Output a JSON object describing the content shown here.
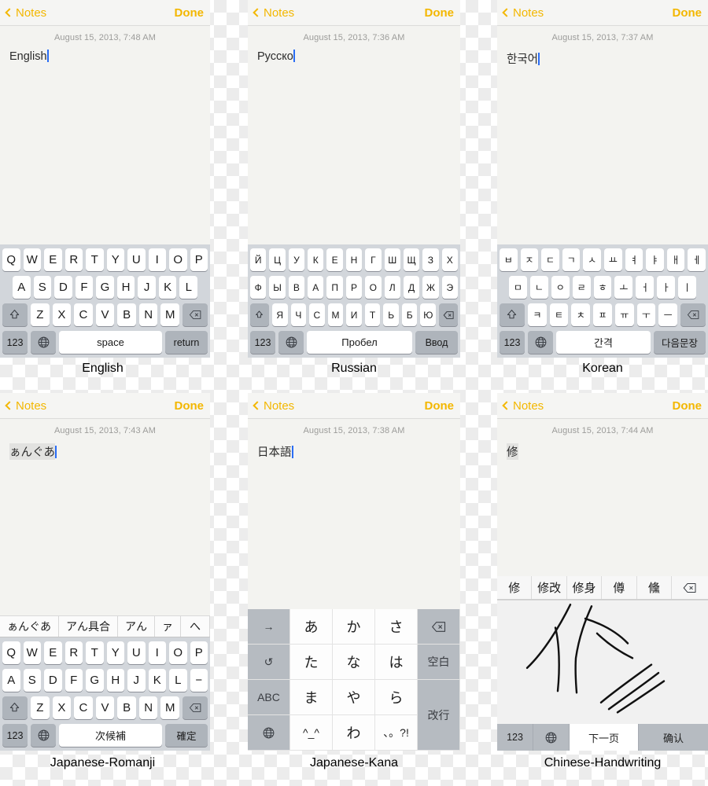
{
  "background": {
    "checker_light": "#ffffff",
    "checker_dark": "#ececec"
  },
  "accent_color": "#f3b700",
  "nav": {
    "back_label": "Notes",
    "done_label": "Done"
  },
  "panels": [
    {
      "caption": "English",
      "date": "August 15, 2013, 7:48 AM",
      "note_text": "English",
      "composing": false,
      "keyboard": {
        "type": "qwerty",
        "rows": [
          [
            "Q",
            "W",
            "E",
            "R",
            "T",
            "Y",
            "U",
            "I",
            "O",
            "P"
          ],
          [
            "A",
            "S",
            "D",
            "F",
            "G",
            "H",
            "J",
            "K",
            "L"
          ],
          [
            "Z",
            "X",
            "C",
            "V",
            "B",
            "N",
            "M"
          ]
        ],
        "shift_label": "shift-icon",
        "delete_label": "delete-icon",
        "numeric_label": "123",
        "globe_label": "globe-icon",
        "space_label": "space",
        "return_label": "return"
      }
    },
    {
      "caption": "Russian",
      "date": "August 15, 2013, 7:36 AM",
      "note_text": "Русско",
      "composing": false,
      "keyboard": {
        "type": "qwerty",
        "rows": [
          [
            "Й",
            "Ц",
            "У",
            "К",
            "Е",
            "Н",
            "Г",
            "Ш",
            "Щ",
            "З",
            "Х"
          ],
          [
            "Ф",
            "Ы",
            "В",
            "А",
            "П",
            "Р",
            "О",
            "Л",
            "Д",
            "Ж",
            "Э"
          ],
          [
            "Я",
            "Ч",
            "С",
            "М",
            "И",
            "Т",
            "Ь",
            "Б",
            "Ю"
          ]
        ],
        "shift_label": "shift-icon",
        "delete_label": "delete-icon",
        "numeric_label": "123",
        "globe_label": "globe-icon",
        "space_label": "Пробел",
        "return_label": "Ввод"
      }
    },
    {
      "caption": "Korean",
      "date": "August 15, 2013, 7:37 AM",
      "note_text": "한국어",
      "composing": false,
      "keyboard": {
        "type": "qwerty",
        "rows": [
          [
            "ㅂ",
            "ㅈ",
            "ㄷ",
            "ㄱ",
            "ㅅ",
            "ㅛ",
            "ㅕ",
            "ㅑ",
            "ㅐ",
            "ㅔ"
          ],
          [
            "ㅁ",
            "ㄴ",
            "ㅇ",
            "ㄹ",
            "ㅎ",
            "ㅗ",
            "ㅓ",
            "ㅏ",
            "ㅣ"
          ],
          [
            "ㅋ",
            "ㅌ",
            "ㅊ",
            "ㅍ",
            "ㅠ",
            "ㅜ",
            "ㅡ"
          ]
        ],
        "shift_label": "shift-icon",
        "delete_label": "delete-icon",
        "numeric_label": "123",
        "globe_label": "globe-icon",
        "space_label": "간격",
        "return_label": "다음문장"
      }
    },
    {
      "caption": "Japanese-Romanji",
      "date": "August 15, 2013, 7:43 AM",
      "note_text": "ぁんぐあ",
      "composing": true,
      "candidates": [
        "ぁんぐあ",
        "アん具合",
        "アん",
        "ァ",
        "へ"
      ],
      "keyboard": {
        "type": "qwerty",
        "rows": [
          [
            "Q",
            "W",
            "E",
            "R",
            "T",
            "Y",
            "U",
            "I",
            "O",
            "P"
          ],
          [
            "A",
            "S",
            "D",
            "F",
            "G",
            "H",
            "J",
            "K",
            "L",
            "−"
          ],
          [
            "Z",
            "X",
            "C",
            "V",
            "B",
            "N",
            "M"
          ]
        ],
        "shift_label": "shift-icon",
        "delete_label": "delete-icon",
        "numeric_label": "123",
        "globe_label": "globe-icon",
        "space_label": "次候補",
        "return_label": "確定"
      }
    },
    {
      "caption": "Japanese-Kana",
      "date": "August 15, 2013, 7:38 AM",
      "note_text": "日本語",
      "composing": false,
      "keyboard": {
        "type": "kana-grid",
        "grid": [
          [
            "→",
            "あ",
            "か",
            "さ",
            "⌫"
          ],
          [
            "↺",
            "た",
            "な",
            "は",
            "空白"
          ],
          [
            "ABC",
            "ま",
            "や",
            "ら",
            "改行"
          ],
          [
            "globe-icon",
            "^_^",
            "わ",
            "、。?!",
            ""
          ]
        ],
        "arrow_label": "→",
        "undo_label": "↺",
        "abc_label": "ABC",
        "globe_label": "globe-icon",
        "delete_label": "⌫",
        "space_label": "空白",
        "return_label": "改行"
      }
    },
    {
      "caption": "Chinese-Handwriting",
      "date": "August 15, 2013, 7:44 AM",
      "note_text": "修",
      "composing": true,
      "candidates": [
        "修",
        "修改",
        "修身",
        "僔",
        "儵"
      ],
      "keyboard": {
        "type": "handwriting",
        "delete_label": "delete-icon",
        "numeric_label": "123",
        "globe_label": "globe-icon",
        "next_page_label": "下一页",
        "confirm_label": "确认",
        "handwriting_character": "修"
      }
    }
  ]
}
